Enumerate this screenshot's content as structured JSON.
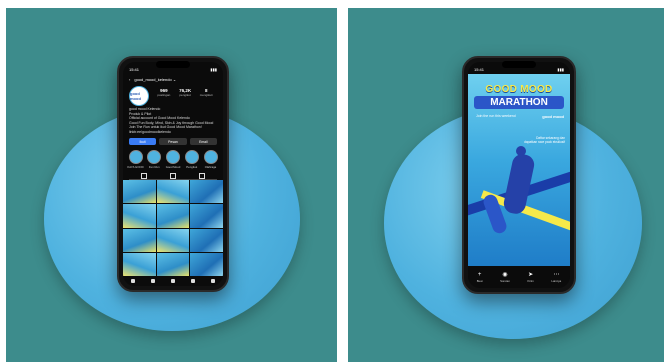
{
  "left_phone": {
    "status_time": "15:41",
    "username": "good_mood_kelendo ⌄",
    "avatar_text": "good mood",
    "stats": [
      {
        "value": "969",
        "label": "postingan"
      },
      {
        "value": "76,2K",
        "label": "pengikut"
      },
      {
        "value": "8",
        "label": "mengikuti"
      }
    ],
    "bio_lines": [
      "good mood Kelendo",
      "Produk & Pilot",
      "Official account of Good Mood Kelendo",
      "Good Fun Body, Mind, Skin & Joy through Good Mood",
      "Join The Run untuk ikut Good Mood Marathon!",
      "linktr.ee/goodmoodkelendo"
    ],
    "buttons": [
      "Ikuti",
      "Pesan",
      "Email"
    ],
    "highlights": [
      "KAYA GOOD",
      "Fun Run",
      "Good Mood",
      "Pengikut",
      "Olahraga"
    ]
  },
  "right_phone": {
    "status_time": "15:41",
    "poster_title_1": "GOOD MOOD",
    "poster_title_2": "MARATHON",
    "poster_sub": "Join the run this weekend",
    "poster_brand": "good mood",
    "poster_info": "Daftar sekarang dan dapatkan race pack eksklusif",
    "actions": [
      {
        "glyph": "+",
        "label": "Buat"
      },
      {
        "glyph": "◉",
        "label": "Sorotan"
      },
      {
        "glyph": "➤",
        "label": "Kirim"
      },
      {
        "glyph": "⋯",
        "label": "Lainnya"
      }
    ]
  },
  "colors": {
    "background": "#3d8c8c",
    "disc": "#4fb2df",
    "accent_yellow": "#f6e94a",
    "accent_blue": "#2b56c8"
  }
}
